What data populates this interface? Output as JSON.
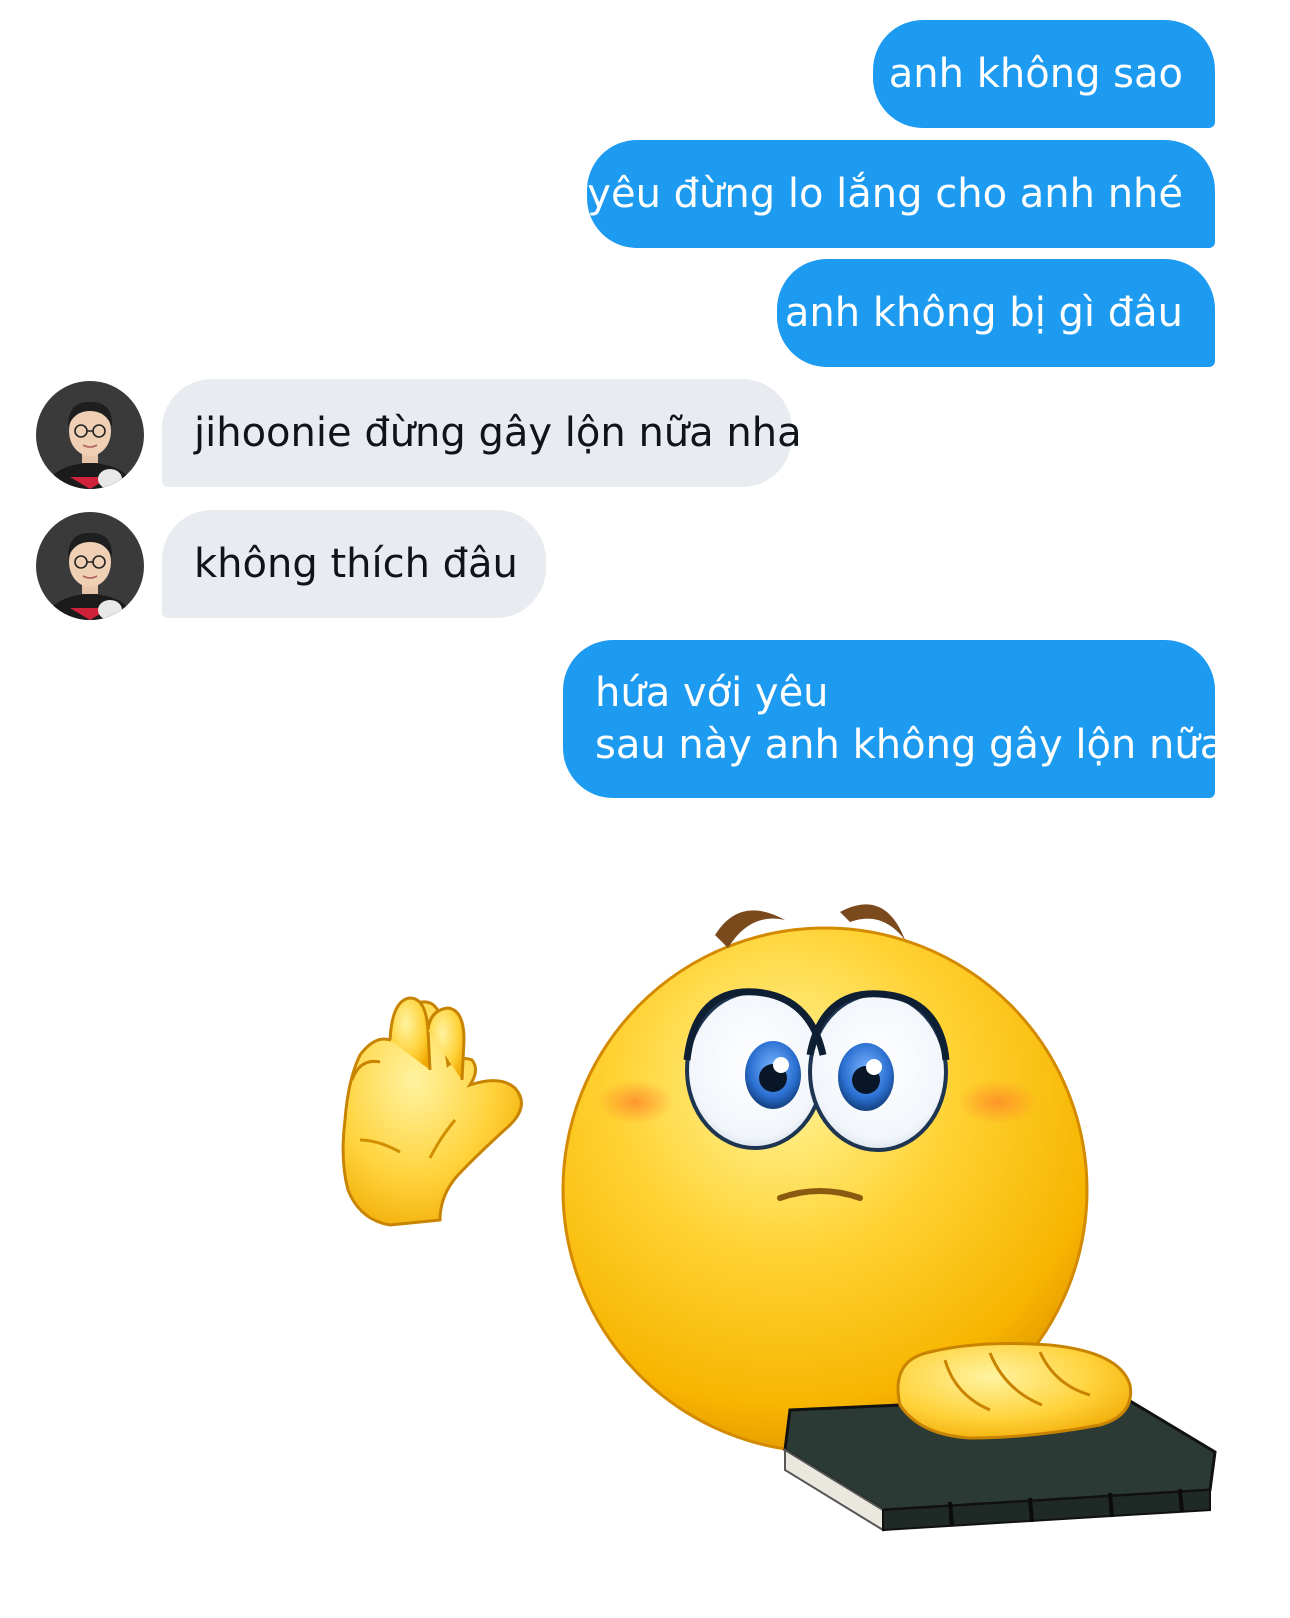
{
  "conversation": {
    "outgoing_1": "anh không sao",
    "outgoing_2": "yêu đừng lo lắng cho anh nhé",
    "outgoing_3": "anh không bị gì đâu",
    "incoming_1": "jihoonie đừng gây lộn nữa nha",
    "incoming_2": "không thích đâu",
    "outgoing_4_line1": "hứa với yêu",
    "outgoing_4_line2": "sau này anh không gây lộn nữa"
  },
  "sticker": {
    "icon": "promise-emoji-sticker"
  },
  "colors": {
    "outgoing_bubble": "#1d9bf0",
    "incoming_bubble": "#e8ebef",
    "emoji_yellow": "#f7b500"
  }
}
